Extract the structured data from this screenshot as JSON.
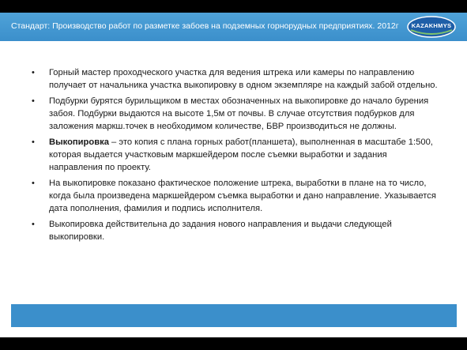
{
  "header": {
    "title": "Стандарт: Производство работ по разметке забоев на подземных горнорудных предприятиях. 2012г",
    "logo_text": "KAZAKHMYS",
    "bar_color": "#3b8fcb"
  },
  "bullets": [
    {
      "text": "Горный мастер проходческого участка для ведения штрека или камеры по направлению получает от начальника участка выкопировку в одном экземпляре на каждый забой отдельно."
    },
    {
      "text": "Подбурки бурятся бурильщиком в местах обозначенных на выкопировке до начало бурения забоя. Подбурки выдаются на высоте 1,5м от почвы. В случае отсутствия подбурков для заложения маркш.точек в необходимом количестве, БВР производиться не должны."
    },
    {
      "bold": "Выкопировка",
      "text": " – это копия с плана горных работ(планшета), выполненная в масштабе 1:500, которая выдается участковым маркшейдером после съемки выработки и задания направления по проекту."
    },
    {
      "text": "На выкопировке показано фактическое положение штрека, выработки в плане на то число, когда была произведена маркшейдером съемка выработки и дано направление. Указывается дата пополнения, фамилия и подпись исполнителя."
    },
    {
      "text": "Выкопировка действительна до задания нового направления и выдачи следующей выкопировки."
    }
  ],
  "bullet_char": "•"
}
